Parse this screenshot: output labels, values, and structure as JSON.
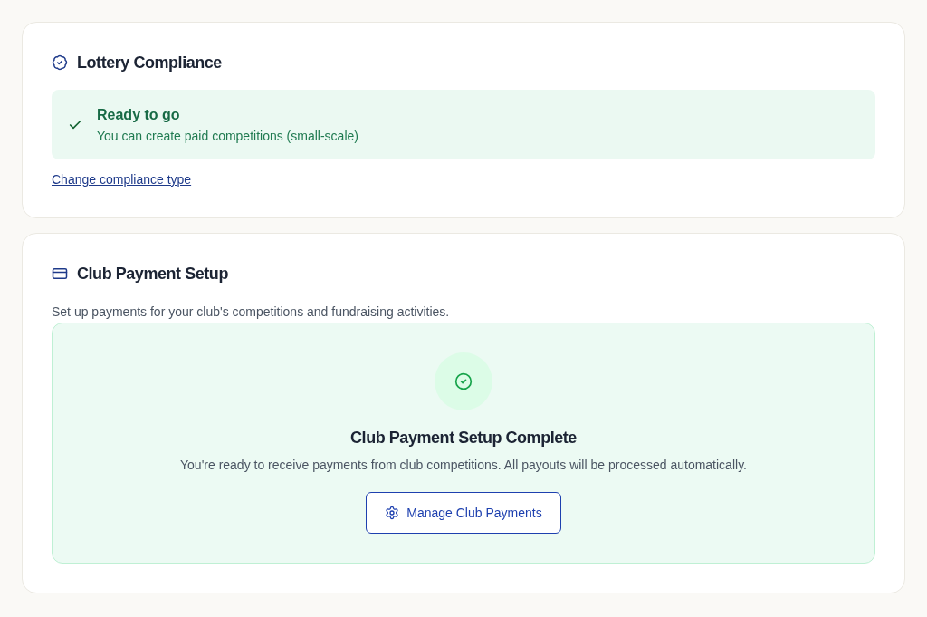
{
  "compliance_card": {
    "title": "Lottery Compliance",
    "status": {
      "title": "Ready to go",
      "message": "You can create paid competitions (small-scale)"
    },
    "link": "Change compliance type"
  },
  "payment_card": {
    "title": "Club Payment Setup",
    "description": "Set up payments for your club's competitions and fundraising activities.",
    "status": {
      "title": "Club Payment Setup Complete",
      "message": "You're ready to receive payments from club competitions. All payouts will be processed automatically.",
      "button": "Manage Club Payments"
    }
  }
}
